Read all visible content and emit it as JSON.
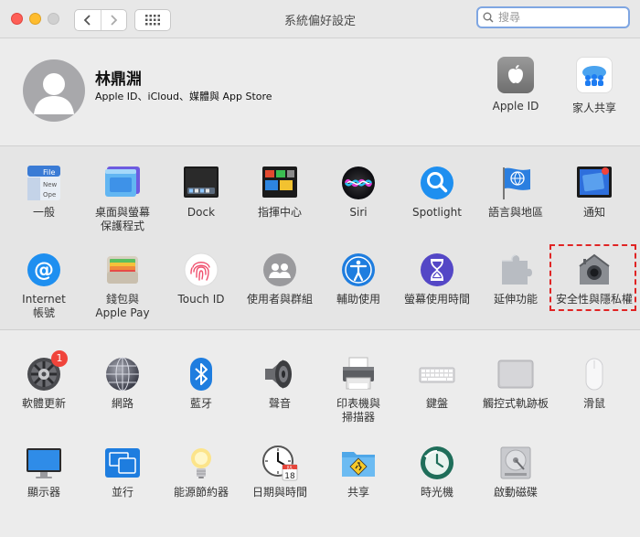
{
  "window": {
    "title": "系統偏好設定"
  },
  "search": {
    "placeholder": "搜尋"
  },
  "account": {
    "name": "林鼎淵",
    "subtitle": "Apple ID、iCloud、媒體與 App Store",
    "items": [
      {
        "label": "Apple ID",
        "icon": "apple-id-icon"
      },
      {
        "label": "家人共享",
        "icon": "family-sharing-icon"
      }
    ]
  },
  "row1": [
    {
      "label": "一般",
      "icon": "general-icon"
    },
    {
      "label": "桌面與螢幕\n保護程式",
      "icon": "desktop-screensaver-icon"
    },
    {
      "label": "Dock",
      "icon": "dock-icon"
    },
    {
      "label": "指揮中心",
      "icon": "mission-control-icon"
    },
    {
      "label": "Siri",
      "icon": "siri-icon"
    },
    {
      "label": "Spotlight",
      "icon": "spotlight-icon"
    },
    {
      "label": "語言與地區",
      "icon": "language-region-icon"
    },
    {
      "label": "通知",
      "icon": "notifications-icon"
    }
  ],
  "row2": [
    {
      "label": "Internet\n帳號",
      "icon": "internet-accounts-icon"
    },
    {
      "label": "錢包與\nApple Pay",
      "icon": "wallet-icon"
    },
    {
      "label": "Touch ID",
      "icon": "touch-id-icon"
    },
    {
      "label": "使用者與群組",
      "icon": "users-groups-icon"
    },
    {
      "label": "輔助使用",
      "icon": "accessibility-icon"
    },
    {
      "label": "螢幕使用時間",
      "icon": "screen-time-icon"
    },
    {
      "label": "延伸功能",
      "icon": "extensions-icon"
    },
    {
      "label": "安全性與隱私權",
      "icon": "security-privacy-icon"
    }
  ],
  "row3": [
    {
      "label": "軟體更新",
      "icon": "software-update-icon",
      "badge": "1"
    },
    {
      "label": "網路",
      "icon": "network-icon"
    },
    {
      "label": "藍牙",
      "icon": "bluetooth-icon"
    },
    {
      "label": "聲音",
      "icon": "sound-icon"
    },
    {
      "label": "印表機與\n掃描器",
      "icon": "printers-scanners-icon"
    },
    {
      "label": "鍵盤",
      "icon": "keyboard-icon"
    },
    {
      "label": "觸控式軌跡板",
      "icon": "trackpad-icon"
    },
    {
      "label": "滑鼠",
      "icon": "mouse-icon"
    }
  ],
  "row4": [
    {
      "label": "顯示器",
      "icon": "displays-icon"
    },
    {
      "label": "並行",
      "icon": "sidecar-icon"
    },
    {
      "label": "能源節約器",
      "icon": "energy-saver-icon"
    },
    {
      "label": "日期與時間",
      "icon": "date-time-icon"
    },
    {
      "label": "共享",
      "icon": "sharing-icon"
    },
    {
      "label": "時光機",
      "icon": "time-machine-icon"
    },
    {
      "label": "啟動磁碟",
      "icon": "startup-disk-icon"
    }
  ],
  "calendar": {
    "month": "JUL",
    "day": "18"
  },
  "colors": {
    "accent": "#1d7cf2",
    "highlight": "#e02424"
  }
}
